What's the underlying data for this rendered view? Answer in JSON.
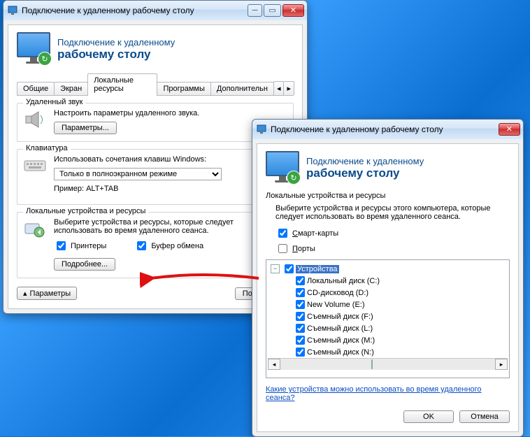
{
  "win1": {
    "title": "Подключение к удаленному рабочему столу",
    "app_title1": "Подключение к удаленному",
    "app_title2": "рабочему столу",
    "tabs": [
      "Общие",
      "Экран",
      "Локальные ресурсы",
      "Программы",
      "Дополнительн"
    ],
    "sound": {
      "group": "Удаленный звук",
      "text": "Настроить параметры удаленного звука.",
      "btn": "Параметры..."
    },
    "keyboard": {
      "group": "Клавиатура",
      "text": "Использовать сочетания клавиш Windows:",
      "combo": "Только в полноэкранном режиме",
      "example": "Пример: ALT+TAB"
    },
    "devices": {
      "group": "Локальные устройства и ресурсы",
      "text": "Выберите устройства и ресурсы, которые следует использовать во время удаленного сеанса.",
      "printers": "Принтеры",
      "clipboard": "Буфер обмена",
      "more": "Подробнее..."
    },
    "footer": {
      "options": "Параметры",
      "connect": "Подключить"
    }
  },
  "win2": {
    "title": "Подключение к удаленному рабочему столу",
    "app_title1": "Подключение к удаленному",
    "app_title2": "рабочему столу",
    "section": "Локальные устройства и ресурсы",
    "text": "Выберите устройства и ресурсы этого компьютера, которые следует использовать во время удаленного сеанса.",
    "smart": "Смарт-карты",
    "ports": "Порты",
    "tree_root": "Устройства",
    "tree": [
      "Локальный диск (C:)",
      "CD-дисковод (D:)",
      "New Volume (E:)",
      "Съемный диск (F:)",
      "Съемный диск (L:)",
      "Съемный диск (M:)",
      "Съемный диск (N:)"
    ],
    "link": "Какие устройства можно использовать во время удаленного сеанса?",
    "ok": "OK",
    "cancel": "Отмена"
  }
}
